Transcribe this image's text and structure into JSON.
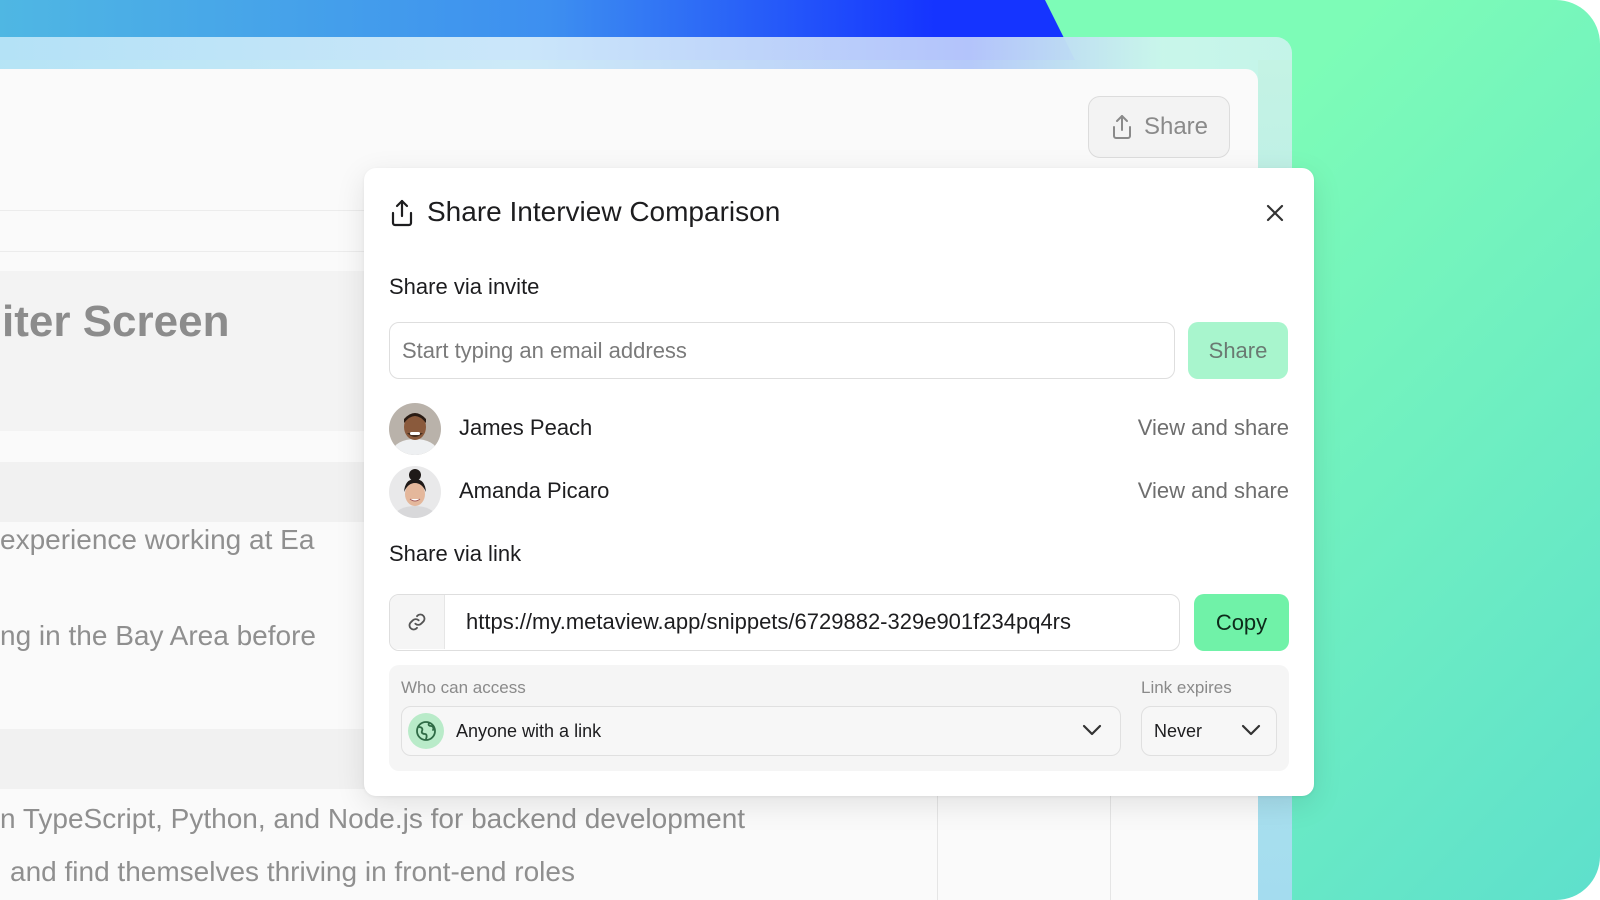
{
  "background_app": {
    "header_share_label": "Share",
    "title_fragment": "iter Screen",
    "text_lines": [
      "experience working at Ea",
      "ng in the Bay Area before",
      "n TypeScript, Python, and Node.js for backend development",
      "and find themselves thriving in front-end roles"
    ]
  },
  "modal": {
    "title": "Share Interview Comparison",
    "invite": {
      "section_label": "Share via invite",
      "email_placeholder": "Start typing an email address",
      "email_value": "",
      "share_label": "Share"
    },
    "people": [
      {
        "name": "James Peach",
        "permission": "View and share"
      },
      {
        "name": "Amanda Picaro",
        "permission": "View and share"
      }
    ],
    "link": {
      "section_label": "Share via link",
      "url": "https://my.metaview.app/snippets/6729882-329e901f234pq4rs",
      "copy_label": "Copy"
    },
    "access": {
      "who_label": "Who can access",
      "who_value": "Anyone with a link",
      "expires_label": "Link expires",
      "expires_value": "Never"
    }
  },
  "icons": {
    "share": "share-icon",
    "close": "close-icon",
    "link": "link-icon",
    "globe": "globe-icon",
    "chevron": "chevron-down-icon"
  },
  "colors": {
    "accent_green": "#70f2a8",
    "accent_green_disabled": "#a8f5cd",
    "backdrop_green": "#7dfcb7",
    "top_blue": "#1534ff"
  }
}
